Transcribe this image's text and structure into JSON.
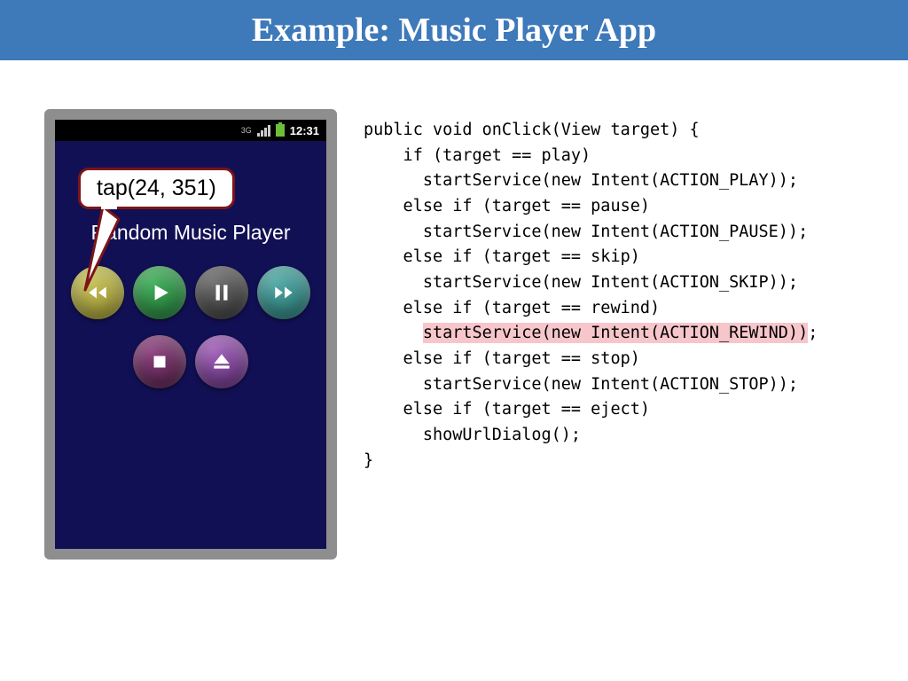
{
  "slide": {
    "title": "Example: Music Player App"
  },
  "phone": {
    "clock": "12:31",
    "network_label": "3G",
    "app_title": "Random Music Player",
    "callout": "tap(24, 351)"
  },
  "code": {
    "l1": "public void onClick(View target) {",
    "l2": "    if (target == play)",
    "l3": "      startService(new Intent(ACTION_PLAY));",
    "l4": "    else if (target == pause)",
    "l5": "      startService(new Intent(ACTION_PAUSE));",
    "l6": "    else if (target == skip)",
    "l7": "      startService(new Intent(ACTION_SKIP));",
    "l8": "    else if (target == rewind)",
    "l9a": "      ",
    "l9b": "startService(new Intent(ACTION_REWIND))",
    "l9c": ";",
    "l10": "    else if (target == stop)",
    "l11": "      startService(new Intent(ACTION_STOP));",
    "l12": "    else if (target == eject)",
    "l13": "      showUrlDialog();",
    "l14": "}"
  }
}
